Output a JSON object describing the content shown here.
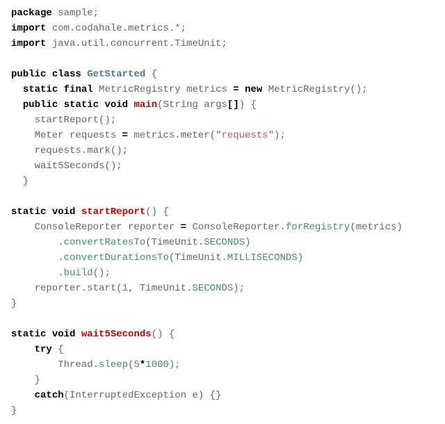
{
  "code": {
    "pkg_kw": "package",
    "pkg_name": " sample;",
    "import_kw": "import",
    "import1": " com.codahale.metrics.",
    "import1_star": "*",
    "import1_end": ";",
    "import2": " java.util.concurrent.TimeUnit;",
    "public_kw": "public",
    "class_kw": "class",
    "classname": "GetStarted",
    "lbrace": " {",
    "static_kw": "static",
    "final_kw": "final",
    "decl1": " MetricRegistry metrics ",
    "eq": "=",
    "new_kw": "new",
    "decl1b": " MetricRegistry();",
    "void_kw": "void",
    "main_fn": "main",
    "main_args": "(String args",
    "main_brackets": "[]",
    "main_close": ") {",
    "call_startReport": "    startReport();",
    "meter_line_a": "    Meter requests ",
    "meter_line_b": " metrics.meter(",
    "str_requests": "\"requests\"",
    "meter_line_c": ");",
    "mark_line": "    requests.mark();",
    "wait_call": "    wait5Seconds();",
    "rbrace": "  }",
    "startReport_fn": "startReport",
    "startReport_args": "() {",
    "cr_a": "    ConsoleReporter reporter ",
    "cr_b": " ConsoleReporter.",
    "forRegistry": "forRegistry",
    "cr_c": "(metrics)",
    "cr_indent": "        .",
    "convertRatesTo": "convertRatesTo",
    "cr_rates_b": "(TimeUnit.",
    "SECONDS": "SECONDS",
    "paren_close": ")",
    "convertDurationsTo": "convertDurationsTo",
    "MILLISECONDS": "MILLISECONDS",
    "build": "build",
    "build_end": "();",
    "reporter_start_a": "    reporter.start(",
    "num1": "1",
    "reporter_start_b": ", TimeUnit.",
    "reporter_start_c": ");",
    "rbrace2": "}",
    "wait5_fn": "wait5Seconds",
    "wait5_args": "() {",
    "try_kw": "try",
    "try_brace": " {",
    "sleep_a": "        Thread.",
    "sleep": "sleep",
    "sleep_b": "(",
    "num5": "5",
    "star2": "*",
    "num1000": "1000",
    "sleep_c": ");",
    "inner_rbrace": "    }",
    "catch_kw": "catch",
    "catch_args": "(InterruptedException e) {}"
  }
}
